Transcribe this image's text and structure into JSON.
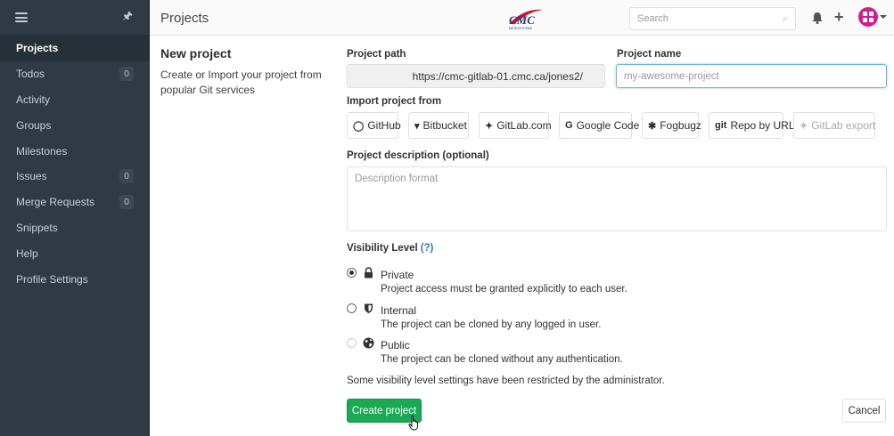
{
  "sidebar": {
    "items": [
      {
        "label": "Projects",
        "badge": null,
        "active": true
      },
      {
        "label": "Todos",
        "badge": "0"
      },
      {
        "label": "Activity",
        "badge": null
      },
      {
        "label": "Groups",
        "badge": null
      },
      {
        "label": "Milestones",
        "badge": null
      },
      {
        "label": "Issues",
        "badge": "0"
      },
      {
        "label": "Merge Requests",
        "badge": "0"
      },
      {
        "label": "Snippets",
        "badge": null
      },
      {
        "label": "Help",
        "badge": null
      },
      {
        "label": "Profile Settings",
        "badge": null
      }
    ]
  },
  "header": {
    "title": "Projects",
    "logo_text": "CMC",
    "logo_subtext": "MICROSYSTEMS",
    "search_placeholder": "Search",
    "avatar_color": "#d81b8f"
  },
  "intro": {
    "heading": "New project",
    "text": "Create or Import your project from popular Git services"
  },
  "form": {
    "path_label": "Project path",
    "path_value": "https://cmc-gitlab-01.cmc.ca/jones2/",
    "name_label": "Project name",
    "name_placeholder": "my-awesome-project",
    "import_label": "Import project from",
    "import_sources": [
      {
        "icon": "github-icon",
        "label": "GitHub",
        "glyph": "◯",
        "enabled": true
      },
      {
        "icon": "bitbucket-icon",
        "label": "Bitbucket",
        "glyph": "▾",
        "enabled": true
      },
      {
        "icon": "gitlab-icon",
        "label": "GitLab.com",
        "glyph": "✦",
        "enabled": true
      },
      {
        "icon": "google-icon",
        "label": "Google Code",
        "glyph": "G",
        "enabled": true
      },
      {
        "icon": "bug-icon",
        "label": "Fogbugz",
        "glyph": "✱",
        "enabled": true
      },
      {
        "icon": "git-icon",
        "label": "Repo by URL",
        "glyph": "git",
        "enabled": true
      },
      {
        "icon": "gitlab-icon",
        "label": "GitLab export",
        "glyph": "✦",
        "enabled": false
      }
    ],
    "description_label": "Project description (optional)",
    "description_placeholder": "Description format",
    "visibility_label": "Visibility Level",
    "visibility_help": "(?)",
    "visibility_options": [
      {
        "name": "Private",
        "desc": "Project access must be granted explicitly to each user.",
        "checked": true,
        "enabled": true,
        "icon": "lock-icon"
      },
      {
        "name": "Internal",
        "desc": "The project can be cloned by any logged in user.",
        "checked": false,
        "enabled": true,
        "icon": "shield-icon"
      },
      {
        "name": "Public",
        "desc": "The project can be cloned without any authentication.",
        "checked": false,
        "enabled": false,
        "icon": "globe-icon"
      }
    ],
    "restriction_note": "Some visibility level settings have been restricted by the administrator.",
    "create_label": "Create project",
    "cancel_label": "Cancel",
    "create_color": "#1aaa55"
  }
}
